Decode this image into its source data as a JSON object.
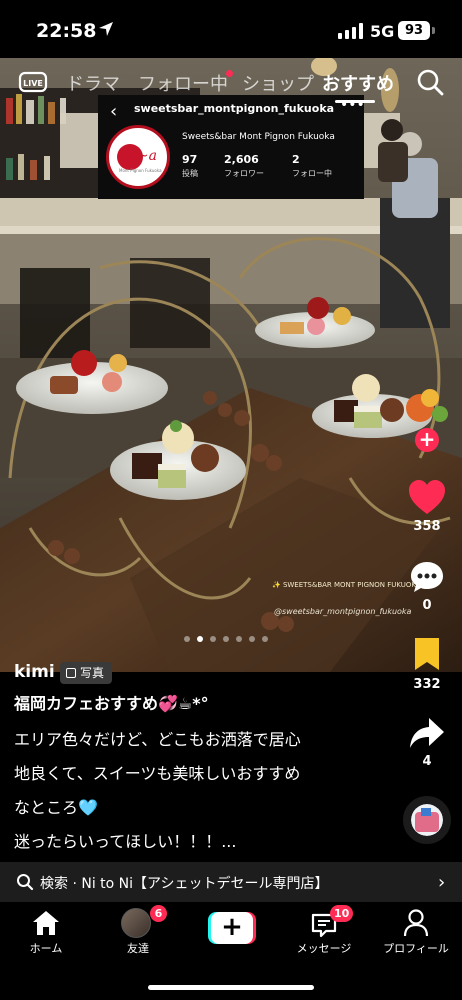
{
  "status_bar": {
    "time": "22:58",
    "network": "5G",
    "battery": "93"
  },
  "top_nav": {
    "tabs": [
      {
        "label": "ドラマ",
        "active": false
      },
      {
        "label": "フォロー中",
        "active": false
      },
      {
        "label": "ショップ",
        "active": false
      },
      {
        "label": "おすすめ",
        "active": true
      }
    ],
    "icons": [
      "live-icon",
      "search-icon"
    ]
  },
  "ig_overlay": {
    "handle": "sweetsbar_montpignon_fukuoka",
    "full_name": "Sweets&bar Mont Pignon Fukuoka",
    "logo_text": "Mont Pignon Fukuoka",
    "stats": [
      {
        "value": "97",
        "label": "投稿"
      },
      {
        "value": "2,606",
        "label": "フォロワー"
      },
      {
        "value": "2",
        "label": "フォロー中"
      }
    ]
  },
  "photo": {
    "watermark_title": "✨ SWEETS&BAR MONT PIGNON FUKUOKA",
    "watermark_handle": "@sweetsbar_montpignon_fukuoka",
    "carousel": {
      "count": 7,
      "active_index": 1
    }
  },
  "actions": {
    "likes": "358",
    "comments": "0",
    "saves": "332",
    "shares": "4"
  },
  "post": {
    "username": "kimi",
    "type_badge": "写真",
    "title": "福岡カフェおすすめ💞☕*°",
    "lines": [
      "エリア色々だけど、どこもお洒落で居心",
      "地良くて、スイーツも美味しいおすすめ",
      "なところ🩵",
      "迷ったらいってほしい！！！..."
    ]
  },
  "search_suggestion": {
    "text": "検索 · Ni to Ni【アシェットデセール専門店】"
  },
  "tab_bar": {
    "items": [
      {
        "label": "ホーム",
        "badge": ""
      },
      {
        "label": "友達",
        "badge": "6"
      },
      {
        "label": "",
        "badge": ""
      },
      {
        "label": "メッセージ",
        "badge": "10"
      },
      {
        "label": "プロフィール",
        "badge": ""
      }
    ]
  },
  "colors": {
    "accent": "#fe2c55",
    "accent_cyan": "#25f4ee",
    "bookmark": "#f7c325",
    "suggest_bg": "#1d1d1d"
  }
}
